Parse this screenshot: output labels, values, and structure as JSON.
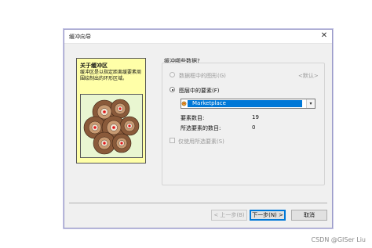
{
  "window": {
    "title": "缓冲向导",
    "close_glyph": "✕"
  },
  "info_panel": {
    "title": "关于缓冲区",
    "description": "缓冲区是以指定距离缓要素周围绘制出的环形区域。"
  },
  "group": {
    "label": "缓冲哪些数据?"
  },
  "options": {
    "graphics": {
      "label": "数据框中的图形(G)",
      "note": "<默认>",
      "checked": false,
      "enabled": false
    },
    "layer_features": {
      "label": "图层中的要素(F)",
      "checked": true,
      "enabled": true
    }
  },
  "layer_select": {
    "value": "Marketplace",
    "icon": "feature-layer-icon",
    "arrow_glyph": "▾"
  },
  "stats": {
    "feature_count_label": "要素数目:",
    "feature_count_value": "19",
    "selected_count_label": "所选要素的数目:",
    "selected_count_value": "0"
  },
  "selected_only": {
    "label": "仅使用所选要素(S)",
    "checked": false,
    "enabled": false
  },
  "buttons": {
    "back": "< 上一步(B)",
    "next": "下一步(N) >",
    "cancel": "取消"
  },
  "watermark": "CSDN @GISer Liu",
  "colors": {
    "accent": "#0078d7",
    "info_bg": "#ffffa8",
    "art_bg": "#e9f6d1"
  }
}
